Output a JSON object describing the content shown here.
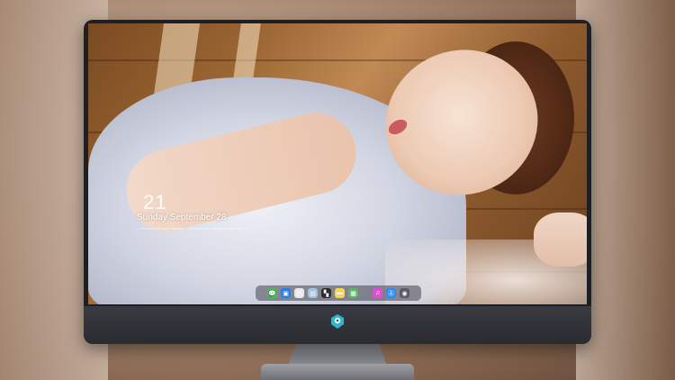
{
  "lockscreen": {
    "time": "21",
    "date": "Sunday September  28",
    "note": "— You are not a good person... not a bad one, simply who you are —"
  },
  "dock": {
    "items": [
      {
        "name": "messages-icon",
        "color": "#3ec14f",
        "glyph": "💬"
      },
      {
        "name": "finder-icon",
        "color": "#2f7de1",
        "glyph": "▣"
      },
      {
        "name": "clock-icon",
        "color": "#e8e8ea",
        "glyph": "◷"
      },
      {
        "name": "preview-icon",
        "color": "#a6c1d8",
        "glyph": "▤"
      },
      {
        "name": "clapper-icon",
        "color": "#2b2b30",
        "glyph": "▚"
      },
      {
        "name": "notes-icon",
        "color": "#f4d35e",
        "glyph": "▬"
      },
      {
        "name": "photos-icon",
        "color": "#5fb46a",
        "glyph": "▦"
      },
      {
        "name": "itunes-icon",
        "color": "#e04fd0",
        "glyph": "♫"
      },
      {
        "name": "appstore-icon",
        "color": "#2d8cf0",
        "glyph": "Ⓐ"
      },
      {
        "name": "camera-icon",
        "color": "#5a5d66",
        "glyph": "◉"
      }
    ]
  }
}
